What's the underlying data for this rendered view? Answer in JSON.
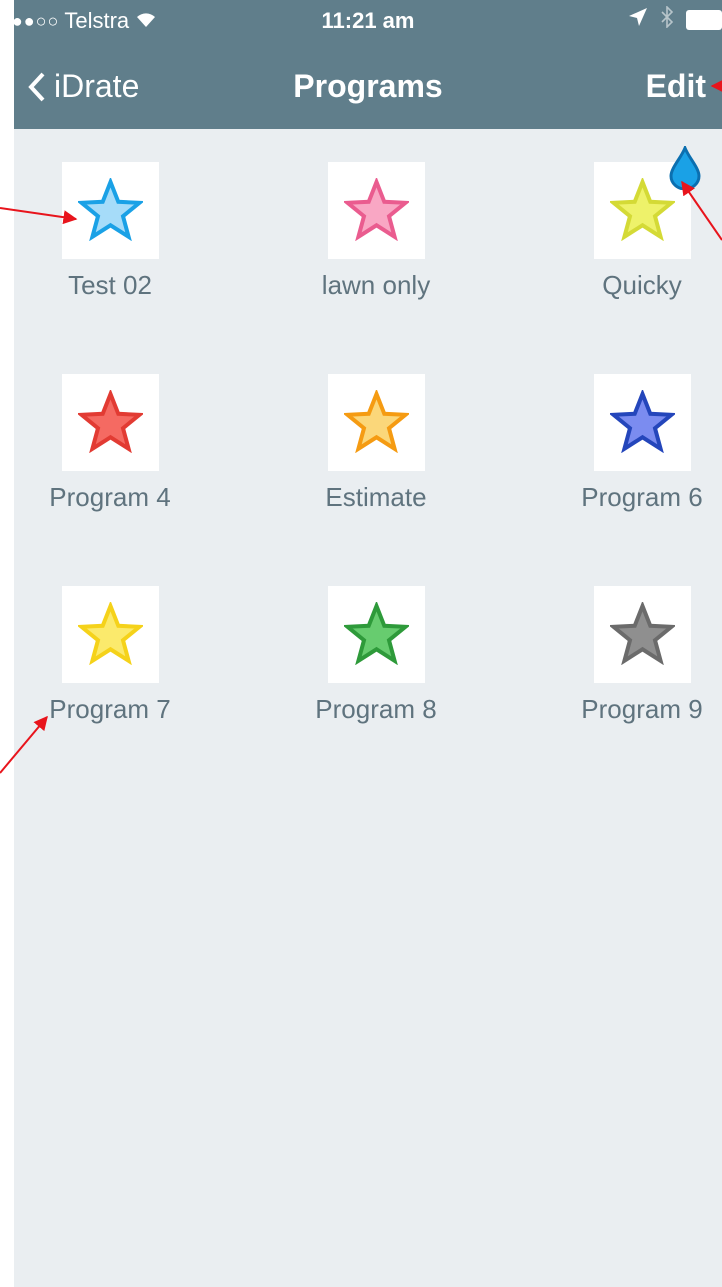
{
  "status_bar": {
    "carrier": "Telstra",
    "time": "11:21 am"
  },
  "nav": {
    "back_label": "iDrate",
    "title": "Programs",
    "edit_label": "Edit"
  },
  "programs": [
    {
      "name": "Test 02",
      "fill": "#a6dcf9",
      "stroke": "#1aa1e6"
    },
    {
      "name": "lawn only",
      "fill": "#f9a7c4",
      "stroke": "#ea5c8f"
    },
    {
      "name": "Quicky",
      "fill": "#eef26a",
      "stroke": "#d4da36"
    },
    {
      "name": "Program 4",
      "fill": "#f56a62",
      "stroke": "#e23b33"
    },
    {
      "name": "Estimate",
      "fill": "#fbd77a",
      "stroke": "#f59b12"
    },
    {
      "name": "Program 6",
      "fill": "#7b8cf0",
      "stroke": "#2446bb"
    },
    {
      "name": "Program 7",
      "fill": "#fbea6c",
      "stroke": "#f5d21a"
    },
    {
      "name": "Program 8",
      "fill": "#67cc6f",
      "stroke": "#2e9a3a"
    },
    {
      "name": "Program 9",
      "fill": "#8f8f8f",
      "stroke": "#6b6b6b"
    }
  ],
  "active_indicator": {
    "icon": "water-drop-icon",
    "program": "Quicky",
    "color": "#1aa1e6"
  },
  "colors": {
    "nav_bg": "#607e8b",
    "content_bg": "#eaeef1",
    "label": "#5f737e",
    "annotation": "#e8141c"
  }
}
